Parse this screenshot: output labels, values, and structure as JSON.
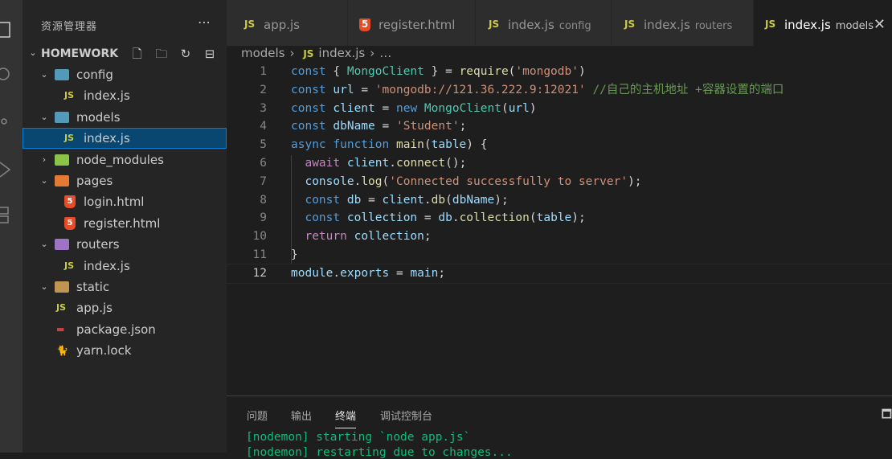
{
  "explorer": {
    "title": "资源管理器",
    "more_icon": "ellipsis-icon",
    "project": "HOMEWORK",
    "actions": [
      "new-file-icon",
      "new-folder-icon",
      "refresh-icon",
      "collapse-all-icon"
    ],
    "tree": [
      {
        "name": "config",
        "type": "folder",
        "expanded": true,
        "depth": 1
      },
      {
        "name": "index.js",
        "type": "js",
        "depth": 2
      },
      {
        "name": "models",
        "type": "folder",
        "expanded": true,
        "depth": 1
      },
      {
        "name": "index.js",
        "type": "js",
        "depth": 2,
        "selected": true
      },
      {
        "name": "node_modules",
        "type": "folder",
        "expanded": false,
        "depth": 1
      },
      {
        "name": "pages",
        "type": "folder",
        "expanded": true,
        "depth": 1
      },
      {
        "name": "login.html",
        "type": "html",
        "depth": 2
      },
      {
        "name": "register.html",
        "type": "html",
        "depth": 2
      },
      {
        "name": "routers",
        "type": "folder",
        "expanded": true,
        "depth": 1
      },
      {
        "name": "index.js",
        "type": "js",
        "depth": 2
      },
      {
        "name": "static",
        "type": "folder",
        "expanded": true,
        "depth": 1
      },
      {
        "name": "app.js",
        "type": "js",
        "depth": 1
      },
      {
        "name": "package.json",
        "type": "json",
        "depth": 1
      },
      {
        "name": "yarn.lock",
        "type": "yarn",
        "depth": 1
      }
    ]
  },
  "tabs": [
    {
      "label": "app.js",
      "desc": "",
      "icon": "JS"
    },
    {
      "label": "register.html",
      "desc": "",
      "icon": "html5-icon"
    },
    {
      "label": "index.js",
      "desc": "config",
      "icon": "JS"
    },
    {
      "label": "index.js",
      "desc": "routers",
      "icon": "JS"
    },
    {
      "label": "index.js",
      "desc": "models",
      "icon": "JS",
      "active": true
    }
  ],
  "breadcrumb": {
    "folder": "models",
    "file": "index.js",
    "rest": "…"
  },
  "code_lines": [
    "1",
    "2",
    "3",
    "4",
    "5",
    "6",
    "7",
    "8",
    "9",
    "10",
    "11",
    "12"
  ],
  "code_text": [
    "const { MongoClient } = require('mongodb')",
    "const url = 'mongodb://121.36.222.9:12021' //自己的主机地址 +容器设置的端口",
    "const client = new MongoClient(url)",
    "const dbName = 'Student';",
    "async function main(table) {",
    "  await client.connect();",
    "  console.log('Connected successfully to server');",
    "  const db = client.db(dbName);",
    "  const collection = db.collection(table);",
    "  return collection;",
    "}",
    "module.exports = main;"
  ],
  "panel": {
    "tabs": [
      "问题",
      "输出",
      "终端",
      "调试控制台"
    ],
    "active": "终端",
    "terminal": [
      "[nodemon] starting `node app.js`",
      "[nodemon] restarting due to changes..."
    ]
  },
  "colors": {
    "accent": "#007fd4",
    "selection": "#094771",
    "terminal_green": "#0dbc79"
  }
}
